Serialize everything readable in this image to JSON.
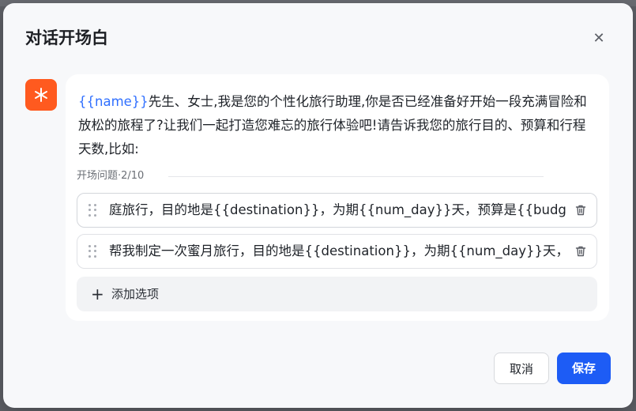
{
  "dialog": {
    "title": "对话开场白",
    "close_icon": "close-icon"
  },
  "avatar": {
    "icon": "asterisk-icon",
    "color": "#ff5a1f"
  },
  "intro": {
    "variable": "{{name}}",
    "text": "先生、女士,我是您的个性化旅行助理,你是否已经准备好开始一段充满冒险和放松的旅程了?让我们一起打造您难忘的旅行体验吧!请告诉我您的旅行目的、预算和行程天数,比如:"
  },
  "questions": {
    "label": "开场问题·2/10",
    "items": [
      {
        "text": "庭旅行，目的地是{{destination}}，为期{{num_day}}天，预算是{{budget}}"
      },
      {
        "text": "帮我制定一次蜜月旅行，目的地是{{destination}}，为期{{num_day}}天，预"
      }
    ],
    "add_label": "添加选项"
  },
  "footer": {
    "cancel_label": "取消",
    "save_label": "保存"
  },
  "colors": {
    "accent": "#1d5cf5",
    "variable": "#2f6fff"
  }
}
